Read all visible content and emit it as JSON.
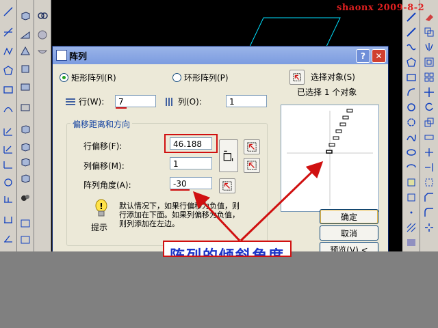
{
  "watermark": "shaonx 2009-8-2",
  "dialog": {
    "title": "阵列",
    "help_glyph": "?",
    "close_glyph": "✕",
    "mode_rect": "矩形阵列(R)",
    "mode_polar": "环形阵列(P)",
    "select_objects": "选择对象(S)",
    "selected_status": "已选择 1 个对象",
    "rows_label": "行(W):",
    "rows_value": "7",
    "cols_label": "列(O):",
    "cols_value": "1",
    "offset_group_title": "偏移距离和方向",
    "row_offset_label": "行偏移(F):",
    "row_offset_value": "46.188",
    "col_offset_label": "列偏移(M):",
    "col_offset_value": "1",
    "angle_label": "阵列角度(A):",
    "angle_value": "-30",
    "tip_text_1": "默认情况下，如果行偏移为负值，则",
    "tip_text_2": "行添加在下面。如果列偏移为负值，",
    "tip_text_3": "则列添加在左边。",
    "tip_label": "提示",
    "ok": "确定",
    "cancel": "取消",
    "preview": "预览(V) <"
  },
  "annotation": {
    "big_label": "阵列的倾斜角度"
  },
  "colors": {
    "annotation_red": "#d01010",
    "annotation_blue": "#1a34c8",
    "cad_cyan": "#00e0ff"
  }
}
